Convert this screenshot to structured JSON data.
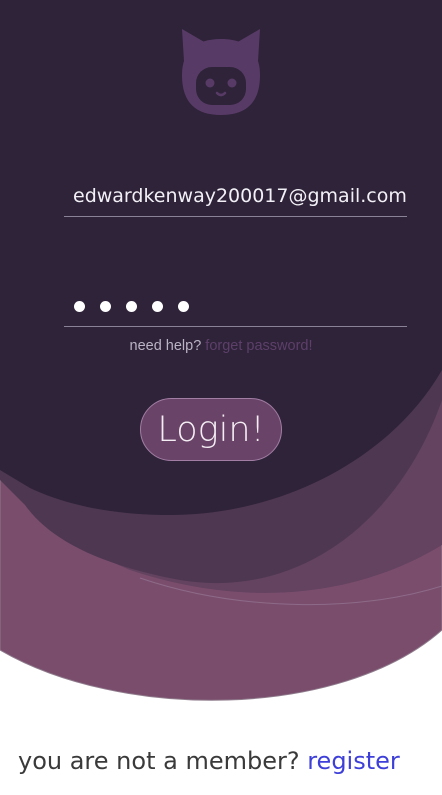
{
  "login_form": {
    "email_value": "edwardkenway200017@gmail.com",
    "password_mask_count": 5,
    "help_prefix": "need help?",
    "help_link": "forget password!",
    "login_label": "Login!"
  },
  "footer": {
    "member_text": "you are not a member?",
    "register_link": "register"
  },
  "icons": {
    "logo": "cat-robot-logo-icon"
  },
  "colors": {
    "background_dark": "#2e2339",
    "wave_light": "#7a4d6d",
    "wave_mid": "#63435f",
    "wave_dark": "#4e3751",
    "button": "#6a4468",
    "link_purple": "#5d3f6a",
    "link_blue": "#3d3fd8"
  }
}
